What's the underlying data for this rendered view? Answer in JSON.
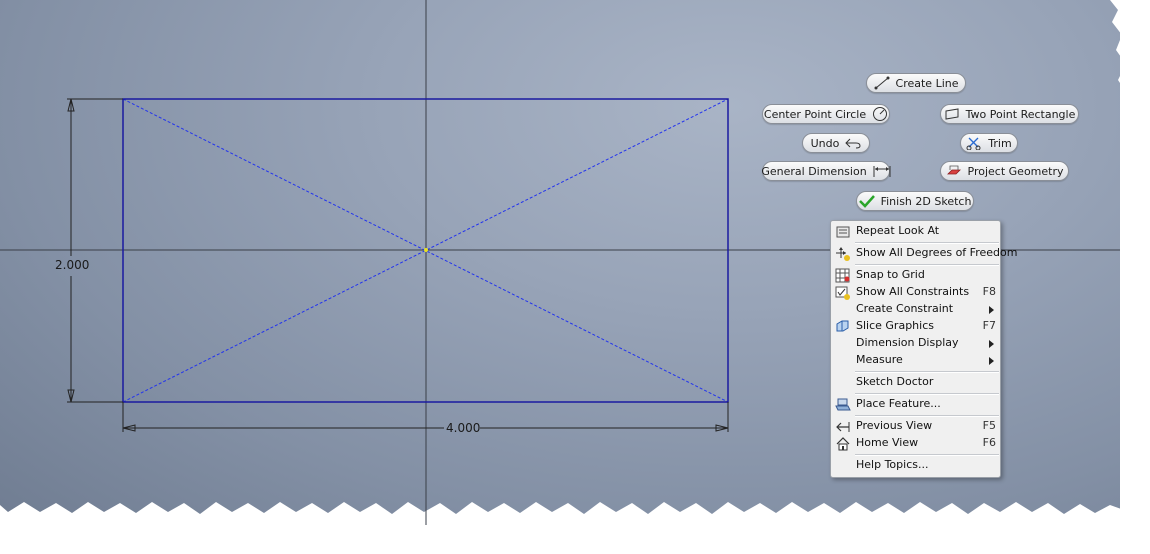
{
  "sketch": {
    "width_dimension": "4.000",
    "height_dimension": "2.000"
  },
  "marking_menu": {
    "create_line": "Create Line",
    "center_point_circle": "Center Point Circle",
    "two_point_rectangle": "Two Point Rectangle",
    "undo": "Undo",
    "trim": "Trim",
    "general_dimension": "General Dimension",
    "project_geometry": "Project Geometry",
    "finish_2d_sketch": "Finish 2D Sketch"
  },
  "context_menu": {
    "items": [
      {
        "label": "Repeat Look At",
        "shortcut": "",
        "icon": "look-at-icon",
        "submenu": false
      },
      {
        "label": "Show All Degrees of Freedom",
        "shortcut": "",
        "icon": "degrees-of-freedom-icon",
        "submenu": false
      },
      {
        "label": "Snap to Grid",
        "shortcut": "",
        "icon": "grid-icon",
        "submenu": false
      },
      {
        "label": "Show All Constraints",
        "shortcut": "F8",
        "icon": "constraints-icon",
        "submenu": false
      },
      {
        "label": "Create Constraint",
        "shortcut": "",
        "icon": "",
        "submenu": true
      },
      {
        "label": "Slice Graphics",
        "shortcut": "F7",
        "icon": "slice-graphics-icon",
        "submenu": false
      },
      {
        "label": "Dimension Display",
        "shortcut": "",
        "icon": "",
        "submenu": true
      },
      {
        "label": "Measure",
        "shortcut": "",
        "icon": "",
        "submenu": true
      },
      {
        "label": "Sketch Doctor",
        "shortcut": "",
        "icon": "",
        "submenu": false
      },
      {
        "label": "Place Feature...",
        "shortcut": "",
        "icon": "place-feature-icon",
        "submenu": false
      },
      {
        "label": "Previous View",
        "shortcut": "F5",
        "icon": "previous-view-icon",
        "submenu": false
      },
      {
        "label": "Home View",
        "shortcut": "F6",
        "icon": "home-view-icon",
        "submenu": false
      },
      {
        "label": "Help Topics...",
        "shortcut": "",
        "icon": "",
        "submenu": false
      }
    ]
  },
  "colors": {
    "sketch_line": "#1a1aa0",
    "construction_line": "#2222ff",
    "finish_check": "#2aa52a"
  }
}
